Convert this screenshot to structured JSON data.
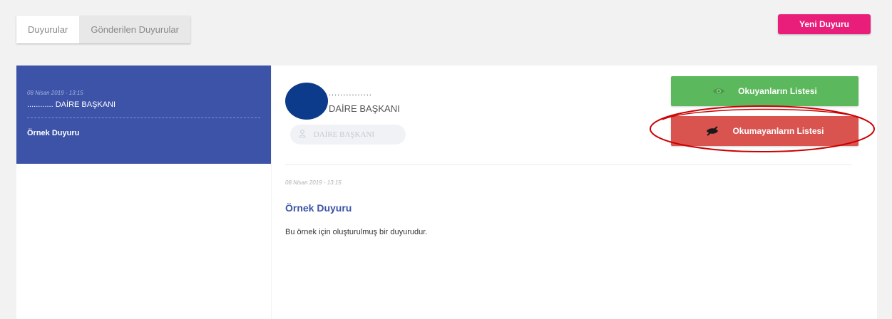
{
  "tabs": [
    {
      "label": "Duyurular",
      "active": false
    },
    {
      "label": "Gönderilen Duyurular",
      "active": true
    }
  ],
  "new_button": {
    "label": "Yeni Duyuru"
  },
  "list": {
    "selected": {
      "date": "08 Nisan 2019 - 13:15",
      "author": "............ DAİRE BAŞKANI",
      "title": "Örnek Duyuru"
    }
  },
  "detail": {
    "sender_name": "...............",
    "sender_title": "DAİRE BAŞKANI",
    "role_chip": "DAİRE BAŞKANI",
    "read_list_label": "Okuyanların Listesi",
    "unread_list_label": "Okumayanların Listesi",
    "date": "08 Nisan 2019 - 13:15",
    "title": "Örnek Duyuru",
    "body": "Bu örnek için oluşturulmuş bir duyurudur."
  },
  "colors": {
    "accent_pink": "#e91e7a",
    "selected_blue": "#3c53a8",
    "read_green": "#5cb85c",
    "unread_red": "#d9534f",
    "avatar_navy": "#0b3b8a",
    "highlight_red": "#cc0000"
  },
  "icons": {
    "read": "eye-icon",
    "unread": "eye-slash-icon",
    "role": "user-icon"
  }
}
